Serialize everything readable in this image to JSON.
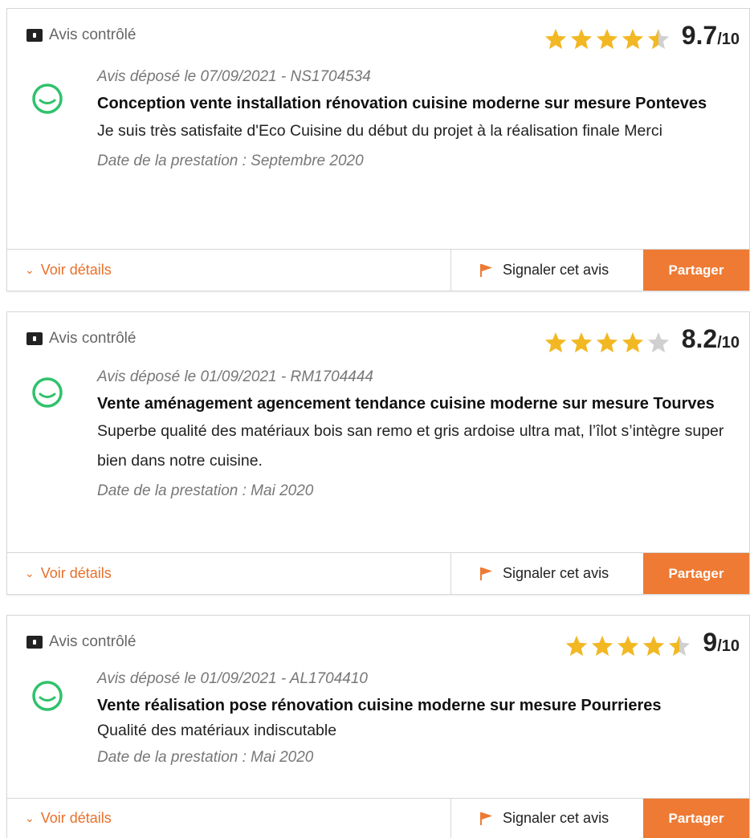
{
  "reviews": [
    {
      "verified_label": "Avis contrôlé",
      "stars": [
        1,
        1,
        1,
        1,
        0.5
      ],
      "score": "9.7",
      "score_suffix": "/10",
      "deposit": "Avis déposé le 07/09/2021 - NS1704534",
      "title": "Conception vente installation rénovation cuisine moderne sur mesure Ponteves",
      "text": "Je suis très satisfaite d'Eco Cuisine du début du projet à la réalisation finale Merci",
      "date": "Date de la prestation : Septembre 2020",
      "details_label": "Voir détails",
      "report_label": "Signaler cet avis",
      "share_label": "Partager"
    },
    {
      "verified_label": "Avis contrôlé",
      "stars": [
        1,
        1,
        1,
        1,
        0
      ],
      "score": "8.2",
      "score_suffix": "/10",
      "deposit": "Avis déposé le 01/09/2021 - RM1704444",
      "title": "Vente aménagement agencement tendance cuisine moderne sur mesure Tourves",
      "text": "Superbe qualité des matériaux bois san remo et gris ardoise ultra mat, l’îlot s’intègre super bien dans notre cuisine.",
      "date": "Date de la prestation : Mai 2020",
      "details_label": "Voir détails",
      "report_label": "Signaler cet avis",
      "share_label": "Partager"
    },
    {
      "verified_label": "Avis contrôlé",
      "stars": [
        1,
        1,
        1,
        1,
        0.5
      ],
      "score": "9",
      "score_suffix": "/10",
      "deposit": "Avis déposé le 01/09/2021 - AL1704410",
      "title": "Vente réalisation pose rénovation cuisine moderne sur mesure Pourrieres",
      "text": "Qualité des matériaux indiscutable",
      "date": "Date de la prestation : Mai 2020",
      "details_label": "Voir détails",
      "report_label": "Signaler cet avis",
      "share_label": "Partager"
    }
  ],
  "colors": {
    "accent": "#ee7a34",
    "link": "#e8702a",
    "star": "#f2b824",
    "star_empty": "#d0d0d0",
    "smiley": "#2fc26b"
  }
}
